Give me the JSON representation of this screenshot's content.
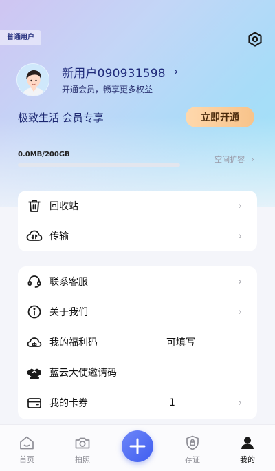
{
  "header": {
    "badge": "普通用户",
    "username": "新用户090931598",
    "vip_tip": "开通会员，畅享更多权益",
    "slogan": "极致生活  会员专享",
    "open_button": "立即开通"
  },
  "storage": {
    "usage_text": "0.0MB/200GB",
    "used_fraction": 0,
    "expand_label": "空间扩容"
  },
  "card1": {
    "items": [
      {
        "label": "回收站"
      },
      {
        "label": "传输"
      }
    ]
  },
  "card2": {
    "items": [
      {
        "label": "联系客服"
      },
      {
        "label": "关于我们"
      },
      {
        "label": "我的福利码",
        "value": "可填写"
      },
      {
        "label": "蓝云大使邀请码"
      },
      {
        "label": "我的卡券",
        "value": "1"
      }
    ]
  },
  "tabs": [
    {
      "label": "首页"
    },
    {
      "label": "拍照"
    },
    {
      "label": "存证"
    },
    {
      "label": "我的"
    }
  ],
  "colors": {
    "accent": "#3f5ef0",
    "title_navy": "#1f2a7a",
    "vip_gold": "#f8c38a"
  },
  "icons": [
    "settings-hexagon-icon",
    "trash-icon",
    "cloud-transfer-icon",
    "headset-icon",
    "info-icon",
    "gift-code-icon",
    "handshake-icon",
    "card-icon",
    "home-icon",
    "camera-icon",
    "plus-icon",
    "shield-lock-icon",
    "user-icon"
  ]
}
